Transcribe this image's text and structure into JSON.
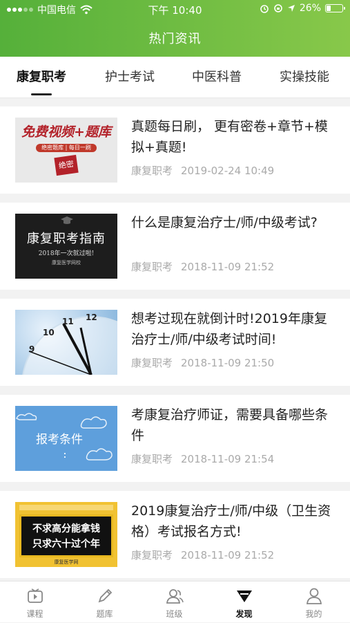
{
  "status_bar": {
    "carrier": "中国电信",
    "time": "下午 10:40",
    "battery": "26%"
  },
  "header": {
    "title": "热门资讯"
  },
  "tabs": [
    {
      "label": "康复职考",
      "active": true
    },
    {
      "label": "护士考试",
      "active": false
    },
    {
      "label": "中医科普",
      "active": false
    },
    {
      "label": "实操技能",
      "active": false
    }
  ],
  "articles": [
    {
      "headline": "真题每日刷，  更有密卷+章节+模拟+真题!",
      "source": "康复职考",
      "time": "2019-02-24 10:49",
      "thumb": {
        "line1": "免费视频+题库",
        "line2": "绝密题库 | 每日一刷",
        "stamp": "绝密"
      }
    },
    {
      "headline": "什么是康复治疗士/师/中级考试?",
      "source": "康复职考",
      "time": "2018-11-09 21:52",
      "thumb": {
        "line1": "康复职考指南",
        "line2": "2018年一次就过啦!",
        "line3": "康复医学网校"
      }
    },
    {
      "headline": "想考过现在就倒计时!2019年康复治疗士/师/中级考试时间!",
      "source": "康复职考",
      "time": "2018-11-09 21:50",
      "thumb": {
        "n1": "10",
        "n2": "11",
        "n3": "12",
        "n4": "9"
      }
    },
    {
      "headline": "考康复治疗师证，需要具备哪些条件",
      "source": "康复职考",
      "time": "2018-11-09 21:54",
      "thumb": {
        "line1": "报考条件",
        "line2": ":"
      }
    },
    {
      "headline": "2019康复治疗士/师/中级（卫生资格）考试报名方式!",
      "source": "康复职考",
      "time": "2018-11-09 21:52",
      "thumb": {
        "line1": "不求高分能拿钱",
        "line2": "只求六十过个年",
        "line3": "康复医学网"
      }
    }
  ],
  "tabbar": [
    {
      "label": "课程",
      "icon": "video-icon",
      "active": false
    },
    {
      "label": "题库",
      "icon": "pencil-icon",
      "active": false
    },
    {
      "label": "班级",
      "icon": "group-icon",
      "active": false
    },
    {
      "label": "发现",
      "icon": "discover-icon",
      "active": true
    },
    {
      "label": "我的",
      "icon": "profile-icon",
      "active": false
    }
  ]
}
